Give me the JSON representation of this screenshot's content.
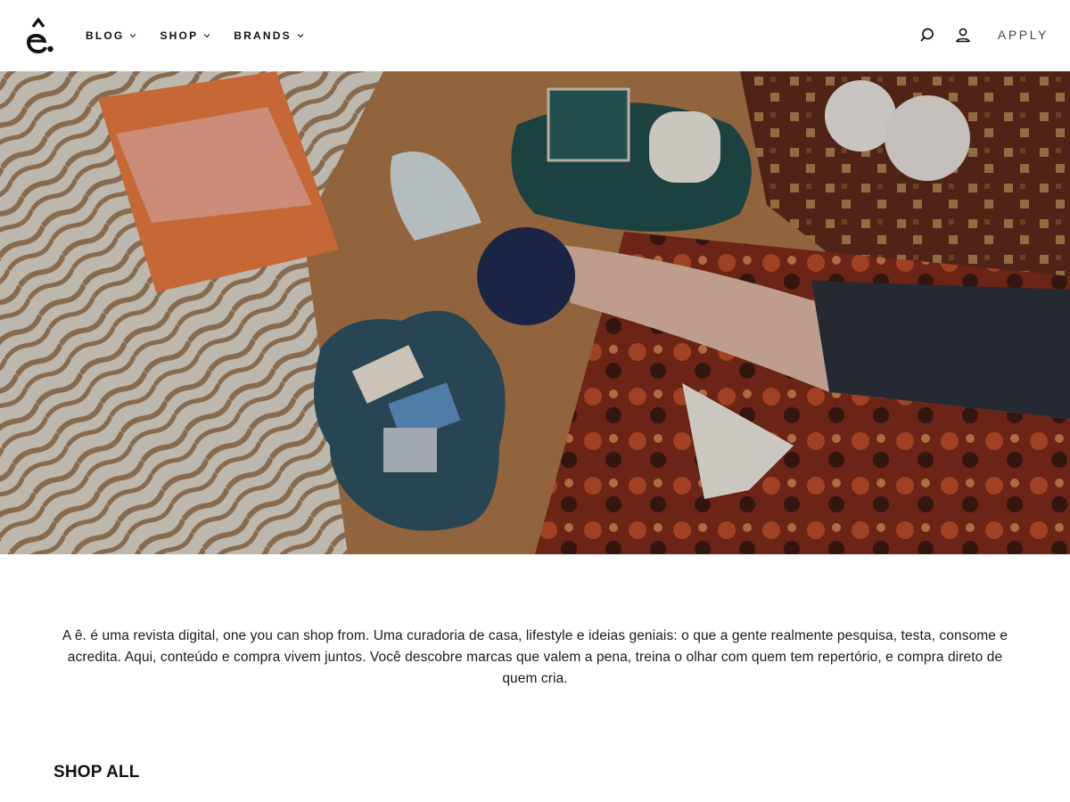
{
  "header": {
    "logo_icon": "e-circumflex-logo-icon",
    "nav": [
      {
        "label": "BLOG"
      },
      {
        "label": "SHOP"
      },
      {
        "label": "BRANDS"
      }
    ],
    "search_icon": "search-icon",
    "account_icon": "user-icon",
    "apply_label": "APPLY"
  },
  "hero": {
    "image_description": "hero-photo-icon"
  },
  "intro": {
    "text": "A ê. é uma revista digital, one you can shop from. Uma curadoria de casa, lifestyle e ideias geniais: o que a gente realmente pesquisa, testa, consome e acredita. Aqui, conteúdo e compra vivem juntos. Você descobre marcas que valem a pena, treina o olhar com quem tem repertório, e compra direto de quem cria."
  },
  "shop_all": {
    "title": "SHOP ALL"
  }
}
